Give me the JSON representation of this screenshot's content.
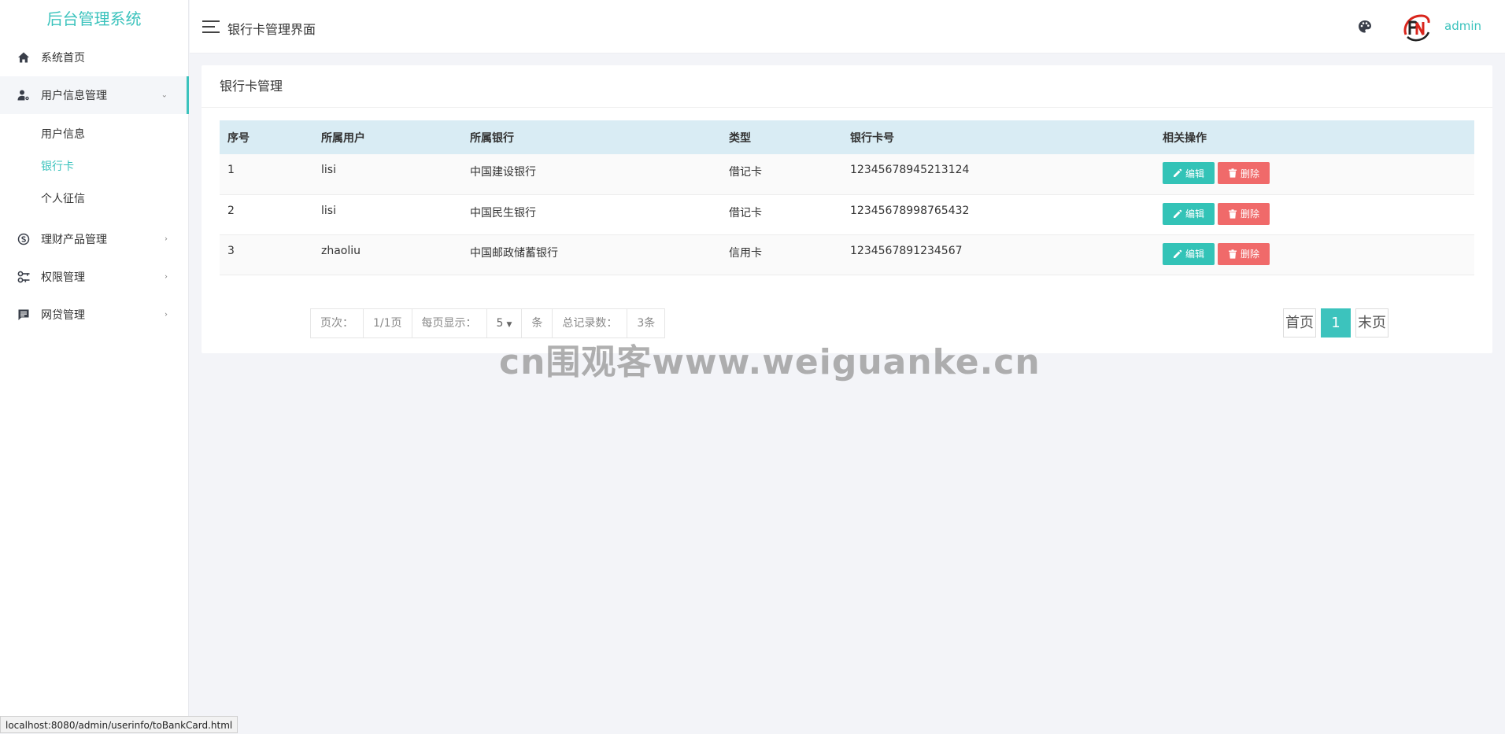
{
  "sidebar": {
    "brand": "后台管理系统",
    "items": [
      {
        "label": "系统首页",
        "icon": "home-icon"
      },
      {
        "label": "用户信息管理",
        "icon": "user-cog-icon",
        "open": true,
        "children": [
          {
            "label": "用户信息"
          },
          {
            "label": "银行卡",
            "active": true
          },
          {
            "label": "个人征信"
          }
        ]
      },
      {
        "label": "理财产品管理",
        "icon": "coin-icon"
      },
      {
        "label": "权限管理",
        "icon": "key-icon"
      },
      {
        "label": "网贷管理",
        "icon": "message-icon"
      }
    ]
  },
  "header": {
    "title": "银行卡管理界面",
    "username": "admin"
  },
  "panel": {
    "title": "银行卡管理",
    "columns": [
      "序号",
      "所属用户",
      "所属银行",
      "类型",
      "银行卡号",
      "相关操作"
    ],
    "rows": [
      {
        "index": "1",
        "user": "lisi",
        "bank": "中国建设银行",
        "type": "借记卡",
        "card": "12345678945213124"
      },
      {
        "index": "2",
        "user": "lisi",
        "bank": "中国民生银行",
        "type": "借记卡",
        "card": "12345678998765432"
      },
      {
        "index": "3",
        "user": "zhaoliu",
        "bank": "中国邮政储蓄银行",
        "type": "信用卡",
        "card": "1234567891234567"
      }
    ],
    "edit_label": "编辑",
    "delete_label": "删除"
  },
  "pagination": {
    "page_label": "页次：",
    "page_value": "1/1页",
    "per_page_label": "每页显示：",
    "per_page_value": "5",
    "per_page_unit": "条",
    "total_label": "总记录数：",
    "total_value": "3条",
    "first_label": "首页",
    "current_page": "1",
    "last_label": "末页"
  },
  "watermark": "cn围观客www.weiguanke.cn",
  "status_url": "localhost:8080/admin/userinfo/toBankCard.html",
  "colors": {
    "accent": "#3cc3bd",
    "edit": "#33c3b7",
    "delete": "#f06a6a",
    "table_header": "#d9ecf4"
  }
}
